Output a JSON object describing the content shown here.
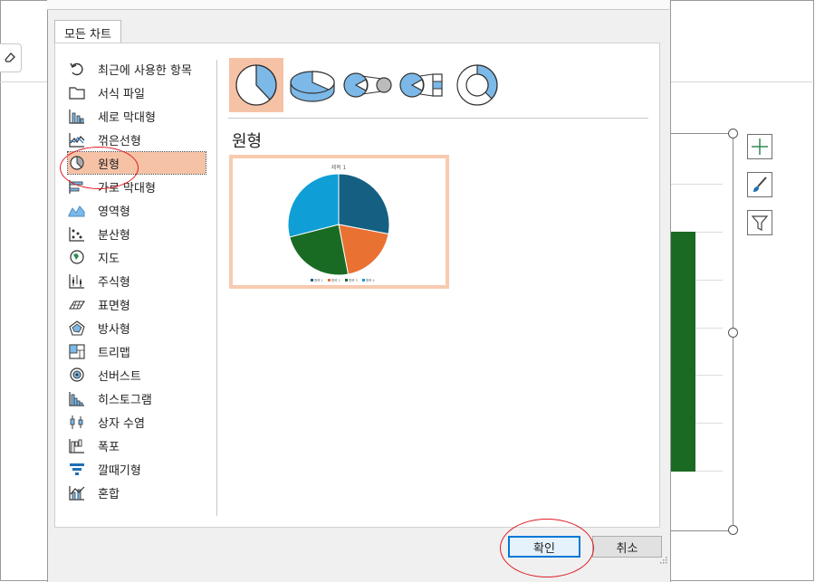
{
  "dialog": {
    "tab_label": "모든 차트",
    "categories": [
      {
        "label": "최근에 사용한 항목",
        "icon": "recent-icon"
      },
      {
        "label": "서식 파일",
        "icon": "folder-icon"
      },
      {
        "label": "세로 막대형",
        "icon": "column-chart-icon"
      },
      {
        "label": "꺾은선형",
        "icon": "line-chart-icon"
      },
      {
        "label": "원형",
        "icon": "pie-chart-icon"
      },
      {
        "label": "가로 막대형",
        "icon": "bar-chart-icon"
      },
      {
        "label": "영역형",
        "icon": "area-chart-icon"
      },
      {
        "label": "분산형",
        "icon": "scatter-chart-icon"
      },
      {
        "label": "지도",
        "icon": "map-chart-icon"
      },
      {
        "label": "주식형",
        "icon": "stock-chart-icon"
      },
      {
        "label": "표면형",
        "icon": "surface-chart-icon"
      },
      {
        "label": "방사형",
        "icon": "radar-chart-icon"
      },
      {
        "label": "트리맵",
        "icon": "treemap-chart-icon"
      },
      {
        "label": "선버스트",
        "icon": "sunburst-chart-icon"
      },
      {
        "label": "히스토그램",
        "icon": "histogram-chart-icon"
      },
      {
        "label": "상자 수염",
        "icon": "box-whisker-chart-icon"
      },
      {
        "label": "폭포",
        "icon": "waterfall-chart-icon"
      },
      {
        "label": "깔때기형",
        "icon": "funnel-chart-icon"
      },
      {
        "label": "혼합",
        "icon": "combo-chart-icon"
      }
    ],
    "selected_category": "원형",
    "subtypes": [
      "pie",
      "3d-pie",
      "pie-of-pie",
      "bar-of-pie",
      "doughnut"
    ],
    "section_title": "원형",
    "preview": {
      "title": "제목 1",
      "legend": [
        "항목 1",
        "항목 2",
        "항목 3",
        "항목 4"
      ],
      "slice_values": [
        0.28,
        0.19,
        0.24,
        0.29
      ],
      "slice_colors": [
        "#156082",
        "#e97132",
        "#196b24",
        "#0f9ed5"
      ]
    },
    "ok_label": "확인",
    "cancel_label": "취소"
  },
  "colors": {
    "selection": "#f6c2a6",
    "annotation": "#e01b24",
    "chart_green": "#1a6a24",
    "primary_border": "#0078d7"
  }
}
